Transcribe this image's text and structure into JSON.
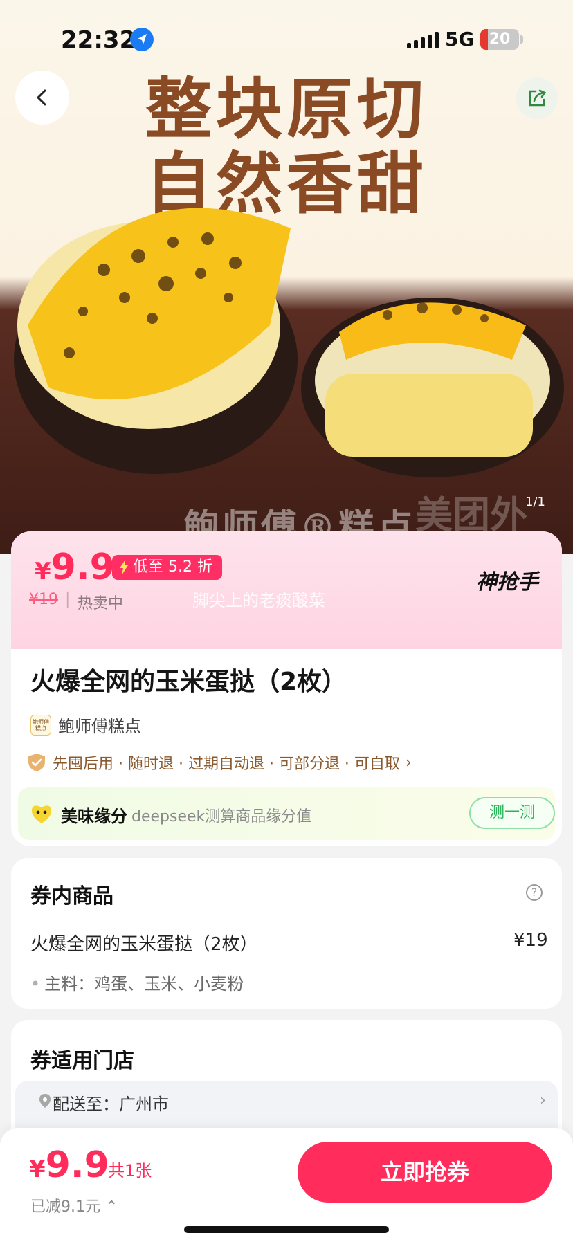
{
  "status_bar": {
    "time": "22:32",
    "network": "5G",
    "battery": "20",
    "battery_level": 0.2
  },
  "hero": {
    "headline_line1": "整块原切",
    "headline_line2": "自然香甜",
    "brand_text": "鲍师傅®糕点",
    "watermark": "美团外",
    "page_indicator": "1/1"
  },
  "price_card": {
    "currency": "¥",
    "price": "9.9",
    "discount": "低至 5.2 折",
    "original_price": "¥19",
    "separator": "|",
    "status": "热卖中",
    "overlay_text": "脚尖上的老痰酸菜",
    "badge": "神抢手",
    "product_title": "火爆全网的玉米蛋挞（2枚）",
    "shop_logo_text": "鲍师傅糕点",
    "shop_name": "鲍师傅糕点",
    "services": "先囤后用 · 随时退 · 过期自动退 · 可部分退 · 可自取",
    "services_arrow": "›",
    "fate_label": "美味缘分",
    "fate_desc": "deepseek测算商品缘分值",
    "fate_button": "测一测"
  },
  "items": {
    "title": "券内商品",
    "help": "?",
    "name": "火爆全网的玉米蛋挞（2枚）",
    "price": "¥19",
    "ingredients": "主料：鸡蛋、玉米、小麦粉"
  },
  "store": {
    "title": "券适用门店",
    "deliver_to": "配送至：广州市",
    "arrow": "›"
  },
  "bottom_bar": {
    "currency": "¥",
    "price": "9.9",
    "count": "共1张",
    "saved": "已减9.1元 ⌃",
    "buy_button": "立即抢券"
  },
  "colors": {
    "accent": "#ff2c5c",
    "hero_text": "#8a4a24",
    "green": "#27b35a"
  }
}
